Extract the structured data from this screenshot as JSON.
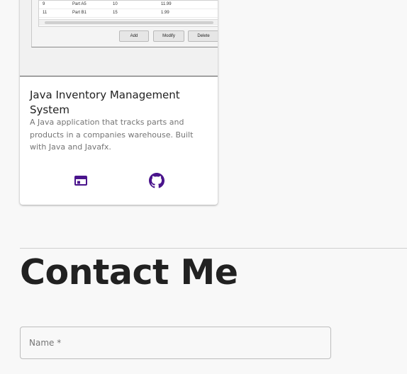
{
  "project_card": {
    "screenshot": {
      "rows": [
        {
          "id": "9",
          "name": "Part A5",
          "inventory": "10",
          "price": "11.99"
        },
        {
          "id": "11",
          "name": "Part B1",
          "inventory": "15",
          "price": "1.99"
        }
      ],
      "buttons": {
        "add": "Add",
        "modify": "Modify",
        "delete": "Delete"
      }
    },
    "title": "Java Inventory Management System",
    "description": "A Java application that tracks parts and products in a companies warehouse. Built with Java and Javafx.",
    "actions": {
      "demo_icon": "web-browser-icon",
      "source_icon": "github-icon",
      "accent_color": "#4a148c"
    }
  },
  "contact": {
    "heading": "Contact Me",
    "name_placeholder": "Name *"
  }
}
